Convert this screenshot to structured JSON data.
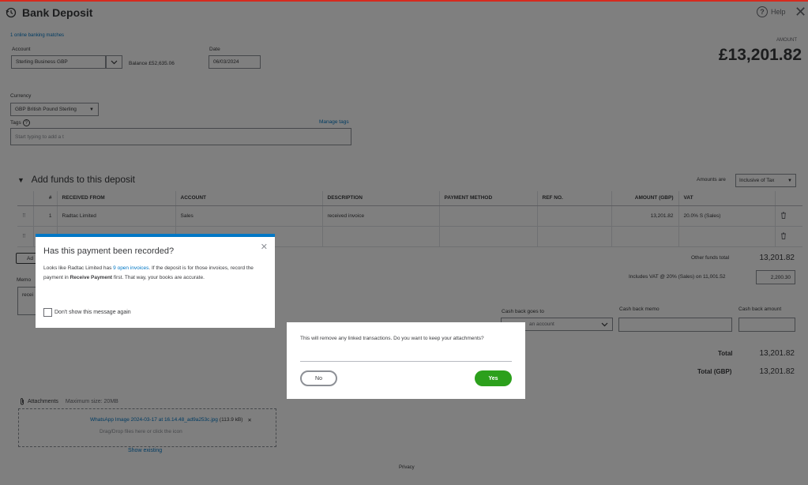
{
  "header": {
    "title": "Bank Deposit",
    "help_label": "Help"
  },
  "form": {
    "banking_link": "1 online banking matches",
    "account_label": "Account",
    "account_value": "Sterling Business GBP",
    "balance_text": "Balance £52,635.06",
    "date_label": "Date",
    "date_value": "06/03/2024",
    "amount_label": "AMOUNT",
    "amount_value": "£13,201.82",
    "currency_label": "Currency",
    "currency_value": "GBP British Pound Sterling",
    "tags_label": "Tags",
    "manage_tags": "Manage tags",
    "tags_placeholder": "Start typing to add a t"
  },
  "deposit": {
    "section_title": "Add funds to this deposit",
    "amounts_are_label": "Amounts are",
    "amounts_are_value": "Inclusive of Tax",
    "columns": [
      "#",
      "RECEIVED FROM",
      "ACCOUNT",
      "DESCRIPTION",
      "PAYMENT METHOD",
      "REF NO.",
      "AMOUNT (GBP)",
      "VAT"
    ],
    "rows": [
      {
        "num": "1",
        "received_from": "Radtac Limited",
        "account": "Sales",
        "description": "received invoice",
        "payment_method": "",
        "ref_no": "",
        "amount": "13,201.82",
        "vat": "20.0% S (Sales)"
      },
      {
        "num": "",
        "received_from": "",
        "account": "",
        "description": "",
        "payment_method": "",
        "ref_no": "",
        "amount": "",
        "vat": ""
      }
    ],
    "add_lines": "Ad",
    "other_funds_label": "Other funds total",
    "other_funds_value": "13,201.82",
    "vat_label": "Includes VAT @ 20% (Sales) on 11,001.52",
    "vat_value": "2,200.30",
    "memo_label": "Memo",
    "memo_value": "recei",
    "cashback_goes_label": "Cash back goes to",
    "cashback_goes_placeholder": "an account",
    "cashback_memo_label": "Cash back memo",
    "cashback_amount_label": "Cash back amount",
    "total_label": "Total",
    "total_value": "13,201.82",
    "total_gbp_label": "Total (GBP)",
    "total_gbp_value": "13,201.82"
  },
  "attachments": {
    "label": "Attachments",
    "max_size": "Maximum size: 20MB",
    "file_name": "WhatsApp Image 2024-03-17 at 16.14.48_ad9a253c.jpg",
    "file_size": "(113.9 kB)",
    "drop_hint": "Drag/Drop files here or click the icon",
    "show_existing": "Show existing"
  },
  "footer": {
    "privacy": "Privacy"
  },
  "dialog_recorded": {
    "title": "Has this payment been recorded?",
    "body_prefix": "Looks like Radtac Limited has ",
    "body_link": "9 open invoices",
    "body_mid": ". If the deposit is for those invoices, record the payment in ",
    "body_bold": "Receive Payment",
    "body_suffix": " first. That way, your books are accurate.",
    "checkbox_label": "Don't show this message again"
  },
  "dialog_attachments": {
    "text": "This will remove any linked transactions. Do you want to keep your attachments?",
    "no_label": "No",
    "yes_label": "Yes"
  },
  "colors": {
    "accent_blue": "#0077c5",
    "yes_green": "#2ca01c",
    "top_red": "#d52b1e"
  }
}
